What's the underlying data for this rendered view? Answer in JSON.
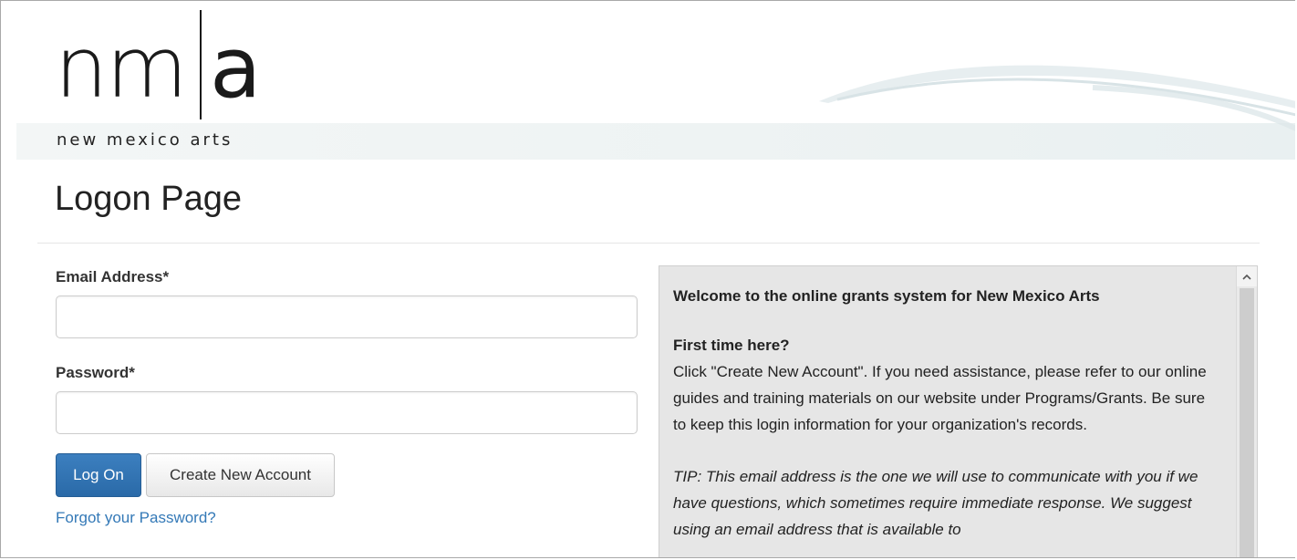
{
  "brand": {
    "logo_left": "nm",
    "logo_right": "a",
    "logo_subtitle": "new mexico arts"
  },
  "page": {
    "title": "Logon Page"
  },
  "form": {
    "email_label": "Email Address*",
    "email_value": "",
    "password_label": "Password*",
    "password_value": "",
    "logon_button": "Log On",
    "create_account_button": "Create New Account",
    "forgot_link": "Forgot your Password?"
  },
  "info": {
    "welcome": "Welcome to the online grants system for New Mexico Arts",
    "first_time_heading": "First time here?",
    "first_time_body": "Click \"Create New Account\". If you need assistance, please refer to our online guides and training materials on our website under Programs/Grants. Be sure to keep this login information for your organization's records.",
    "tip": "TIP: This email address is the one we will use to communicate with you if we have questions, which sometimes require immediate response. We suggest using an email address that is available to"
  },
  "icons": {
    "scroll_up": "chevron-up-icon"
  },
  "colors": {
    "primary_button": "#2f72b2",
    "link": "#3479b7",
    "panel_background": "#e6e6e6"
  }
}
